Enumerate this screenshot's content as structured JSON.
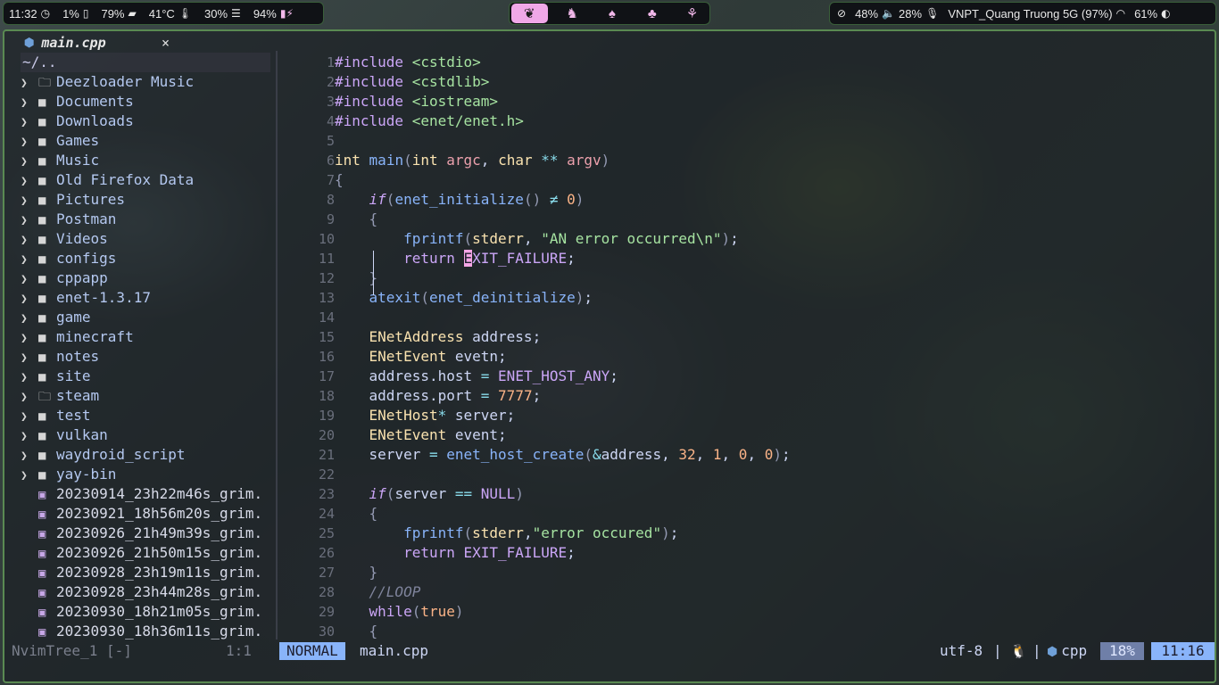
{
  "topbar": {
    "time": "11:32",
    "cpu": "1%",
    "memory": "79%",
    "temperature": "41°C",
    "load": "30%",
    "battery": "94%",
    "workspaces": [
      {
        "icon": "leaf-icon",
        "glyph": "❦",
        "active": true
      },
      {
        "icon": "cat-icon",
        "glyph": "♞",
        "active": false
      },
      {
        "icon": "mushroom-icon",
        "glyph": "♠",
        "active": false
      },
      {
        "icon": "tree-icon",
        "glyph": "♣",
        "active": false
      },
      {
        "icon": "sprout-icon",
        "glyph": "⚘",
        "active": false
      }
    ],
    "volume": "48%",
    "mic": "28%",
    "wifi": "VNPT_Quang Truong 5G (97%)",
    "brightness": "61%"
  },
  "editor": {
    "tab_filename": "main.cpp",
    "tab_close": "×",
    "tree": {
      "root": "~/..",
      "folders": [
        {
          "name": "Deezloader Music",
          "open_icon": true
        },
        {
          "name": "Documents"
        },
        {
          "name": "Downloads"
        },
        {
          "name": "Games"
        },
        {
          "name": "Music"
        },
        {
          "name": "Old Firefox Data"
        },
        {
          "name": "Pictures"
        },
        {
          "name": "Postman"
        },
        {
          "name": "Videos"
        },
        {
          "name": "configs"
        },
        {
          "name": "cppapp"
        },
        {
          "name": "enet-1.3.17"
        },
        {
          "name": "game"
        },
        {
          "name": "minecraft"
        },
        {
          "name": "notes"
        },
        {
          "name": "site"
        },
        {
          "name": "steam",
          "open_icon": true
        },
        {
          "name": "test"
        },
        {
          "name": "vulkan"
        },
        {
          "name": "waydroid_script"
        },
        {
          "name": "yay-bin"
        }
      ],
      "files": [
        "20230914_23h22m46s_grim.",
        "20230921_18h56m20s_grim.",
        "20230926_21h49m39s_grim.",
        "20230926_21h50m15s_grim.",
        "20230928_23h19m11s_grim.",
        "20230928_23h44m28s_grim.",
        "20230930_18h21m05s_grim.",
        "20230930_18h36m11s_grim."
      ]
    },
    "code_lines": [
      {
        "n": "1",
        "html": "<span class=\"kw\">#include</span> <span class=\"st\">&lt;cstdio&gt;</span>"
      },
      {
        "n": "2",
        "html": "<span class=\"kw\">#include</span> <span class=\"st\">&lt;cstdlib&gt;</span>"
      },
      {
        "n": "3",
        "html": "<span class=\"kw\">#include</span> <span class=\"st\">&lt;iostream&gt;</span>"
      },
      {
        "n": "4",
        "html": "<span class=\"kw\">#include</span> <span class=\"st\">&lt;enet/enet.h&gt;</span>"
      },
      {
        "n": "5",
        "html": ""
      },
      {
        "n": "6",
        "html": "<span class=\"ty\">int</span> <span class=\"fn\">main</span><span class=\"br\">(</span><span class=\"ty\">int</span> <span class=\"pa\">argc</span>, <span class=\"ty\">char</span> <span class=\"op\">**</span> <span class=\"pa\">argv</span><span class=\"br\">)</span>"
      },
      {
        "n": "7",
        "html": "<span class=\"br\">{</span>"
      },
      {
        "n": "8",
        "html": "    <span class=\"kwi\">if</span><span class=\"br\">(</span><span class=\"fn\">enet_initialize</span><span class=\"br\">()</span> <span class=\"op\">≠</span> <span class=\"nu\">0</span><span class=\"br\">)</span>"
      },
      {
        "n": "9",
        "html": "    <span class=\"br\">{</span>"
      },
      {
        "n": "10",
        "html": "        <span class=\"fn\">fprintf</span><span class=\"br\">(</span><span class=\"ty\">stderr</span>, <span class=\"st\">\"AN error occurred\\n\"</span><span class=\"br\">)</span>;"
      },
      {
        "n": "11",
        "html": "        <span class=\"kw\">return</span> <span class=\"cursor\">E</span><span class=\"ma\">XIT_FAILURE</span>;"
      },
      {
        "n": "12",
        "html": "    <span class=\"br\">}</span>"
      },
      {
        "n": "13",
        "html": "    <span class=\"fn\">atexit</span><span class=\"br\">(</span><span class=\"fn\">enet_deinitialize</span><span class=\"br\">)</span>;"
      },
      {
        "n": "14",
        "html": ""
      },
      {
        "n": "15",
        "html": "    <span class=\"ty\">ENetAddress</span> address;"
      },
      {
        "n": "16",
        "html": "    <span class=\"ty\">ENetEvent</span> evetn;"
      },
      {
        "n": "17",
        "html": "    address.host <span class=\"op\">=</span> <span class=\"ma\">ENET_HOST_ANY</span>;"
      },
      {
        "n": "18",
        "html": "    address.port <span class=\"op\">=</span> <span class=\"nu\">7777</span>;"
      },
      {
        "n": "19",
        "html": "    <span class=\"ty\">ENetHost</span><span class=\"op\">*</span> server;"
      },
      {
        "n": "20",
        "html": "    <span class=\"ty\">ENetEvent</span> event;"
      },
      {
        "n": "21",
        "html": "    server <span class=\"op\">=</span> <span class=\"fn\">enet_host_create</span><span class=\"br\">(</span><span class=\"op\">&amp;</span>address, <span class=\"nu\">32</span>, <span class=\"nu\">1</span>, <span class=\"nu\">0</span>, <span class=\"nu\">0</span><span class=\"br\">)</span>;"
      },
      {
        "n": "22",
        "html": ""
      },
      {
        "n": "23",
        "html": "    <span class=\"kwi\">if</span><span class=\"br\">(</span>server <span class=\"op\">==</span> <span class=\"ma\">NULL</span><span class=\"br\">)</span>"
      },
      {
        "n": "24",
        "html": "    <span class=\"br\">{</span>"
      },
      {
        "n": "25",
        "html": "        <span class=\"fn\">fprintf</span><span class=\"br\">(</span><span class=\"ty\">stderr</span>,<span class=\"st\">\"error occured\"</span><span class=\"br\">)</span>;"
      },
      {
        "n": "26",
        "html": "        <span class=\"kw\">return</span> <span class=\"ma\">EXIT_FAILURE</span>;"
      },
      {
        "n": "27",
        "html": "    <span class=\"br\">}</span>"
      },
      {
        "n": "28",
        "html": "    <span class=\"cm\">//LOOP</span>"
      },
      {
        "n": "29",
        "html": "    <span class=\"kw\">while</span><span class=\"br\">(</span><span class=\"nu\">true</span><span class=\"br\">)</span>"
      },
      {
        "n": "30",
        "html": "    <span class=\"br\">{</span>"
      }
    ],
    "status": {
      "tree_name": "NvimTree_1 [-]",
      "tree_pos": "1:1",
      "mode": "NORMAL",
      "filename": "main.cpp",
      "encoding": "utf-8",
      "separator": "|",
      "os_icon": "🐧",
      "filetype": "cpp",
      "percent": "18%",
      "position": "11:16"
    }
  }
}
